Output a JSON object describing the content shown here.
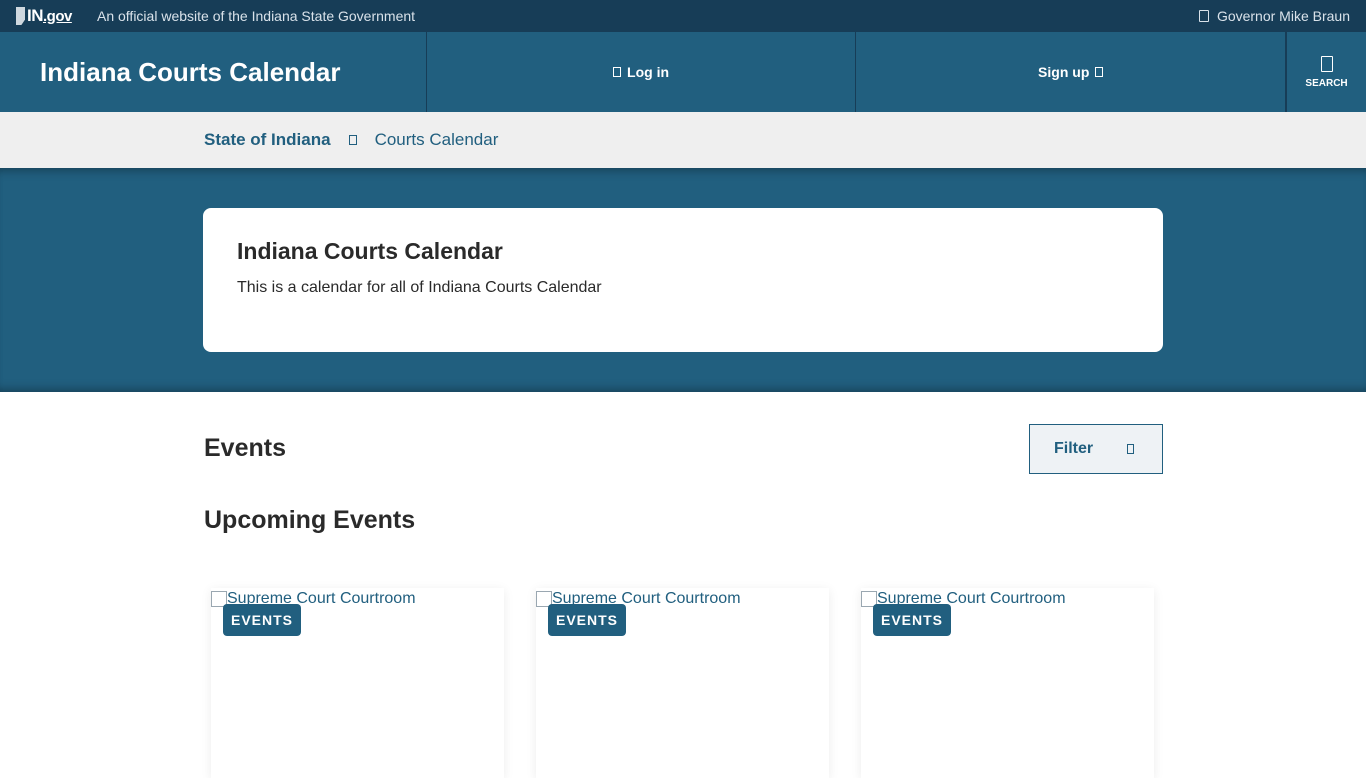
{
  "topbar": {
    "logo_text": "IN",
    "logo_suffix": ".gov",
    "official_text": "An official website of the Indiana State Government",
    "governor_text": "Governor Mike Braun"
  },
  "header": {
    "site_title": "Indiana Courts Calendar",
    "login_label": "Log in",
    "signup_label": "Sign up",
    "search_label": "SEARCH"
  },
  "breadcrumb": {
    "home_label": "State of Indiana",
    "current_label": "Courts Calendar"
  },
  "hero": {
    "title": "Indiana Courts Calendar",
    "description": "This is a calendar for all of Indiana Courts Calendar"
  },
  "events": {
    "title": "Events",
    "filter_label": "Filter",
    "upcoming_title": "Upcoming Events",
    "cards": [
      {
        "image_alt": "Supreme Court Courtroom",
        "tag": "EVENTS"
      },
      {
        "image_alt": "Supreme Court Courtroom",
        "tag": "EVENTS"
      },
      {
        "image_alt": "Supreme Court Courtroom",
        "tag": "EVENTS"
      }
    ]
  },
  "colors": {
    "primary": "#215f7f",
    "topbar": "#173d57",
    "breadcrumb_bg": "#efefef"
  }
}
